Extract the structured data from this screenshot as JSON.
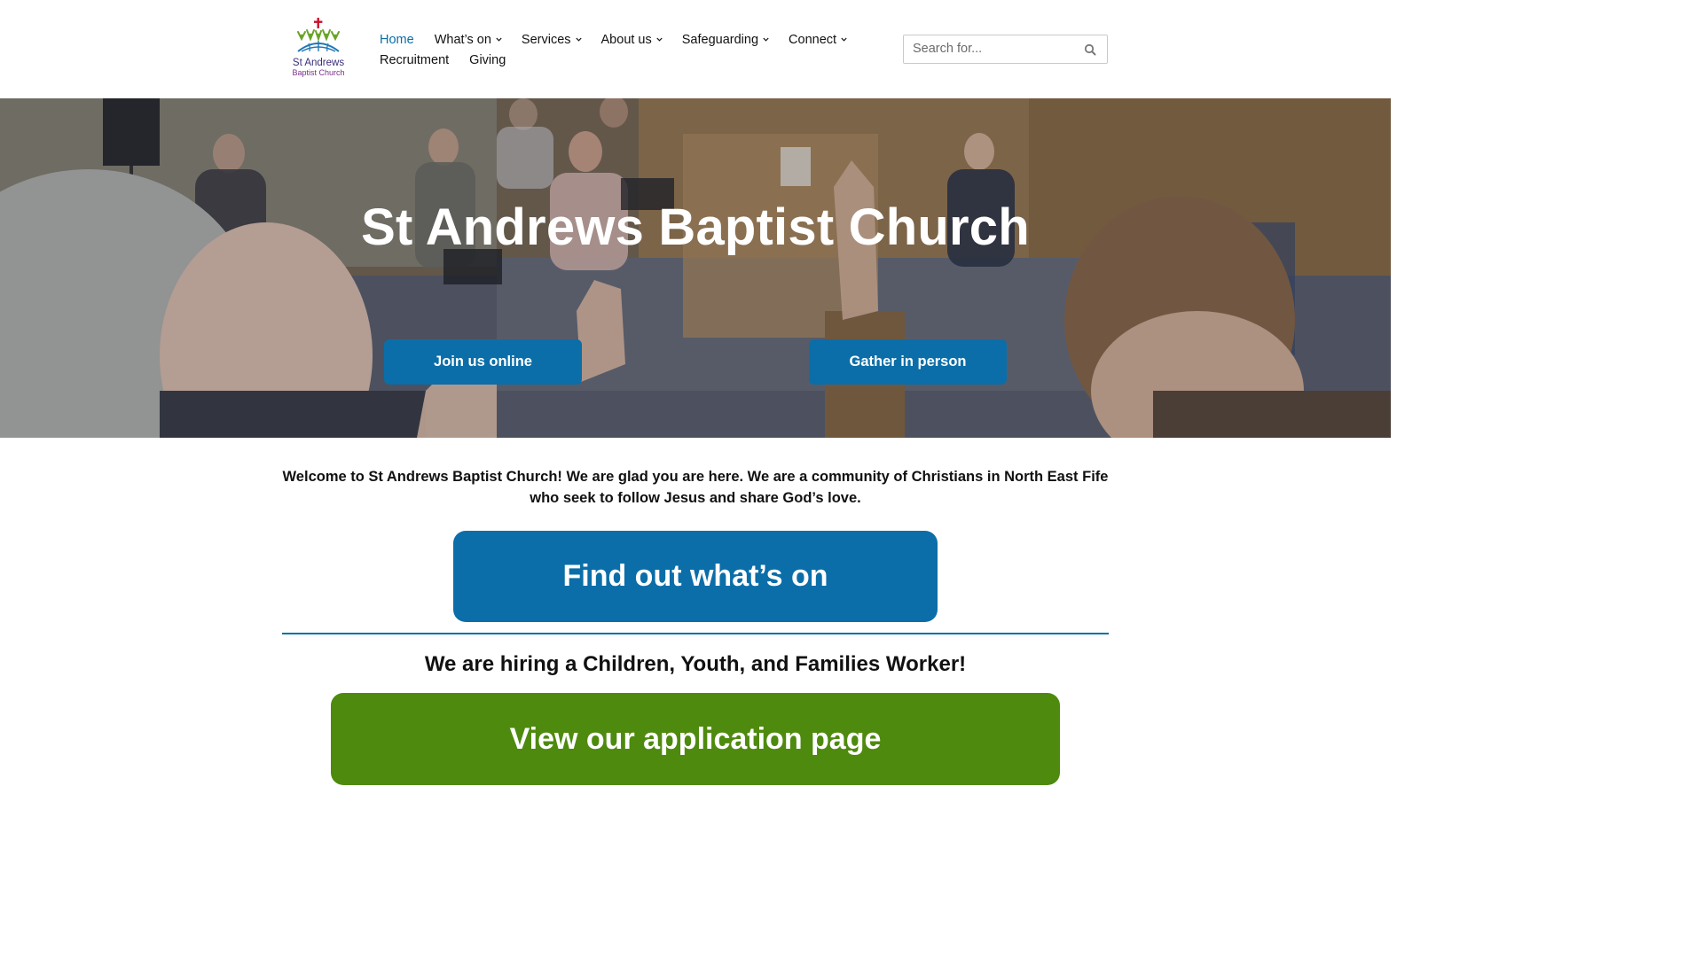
{
  "site": {
    "logo_line1": "St Andrews",
    "logo_line2": "Baptist Church"
  },
  "nav": {
    "row1": [
      {
        "label": "Home",
        "has_dropdown": false,
        "active": true
      },
      {
        "label": "What’s on",
        "has_dropdown": true
      },
      {
        "label": "Services",
        "has_dropdown": true
      },
      {
        "label": "About us",
        "has_dropdown": true
      },
      {
        "label": "Safeguarding",
        "has_dropdown": true
      },
      {
        "label": "Connect",
        "has_dropdown": true
      }
    ],
    "row2": [
      {
        "label": "Recruitment",
        "has_dropdown": false
      },
      {
        "label": "Giving",
        "has_dropdown": false
      }
    ]
  },
  "search": {
    "placeholder": "Search for...",
    "icon": "search-icon"
  },
  "hero": {
    "title": "St Andrews Baptist Church",
    "btn_online": "Join us online",
    "btn_person": "Gather in person"
  },
  "main": {
    "welcome": "Welcome to St Andrews Baptist Church! We are glad you are here. We are a community of Christians in North East Fife who seek to follow Jesus and share God’s love.",
    "cta_whats_on": "Find out what’s on",
    "hiring_heading": "We are hiring a Children, Youth, and Families Worker!",
    "cta_application": "View our application page"
  },
  "colors": {
    "accent_blue": "#0b6ea8",
    "accent_green": "#4e8a0e",
    "active_nav": "#0b6ea8"
  }
}
